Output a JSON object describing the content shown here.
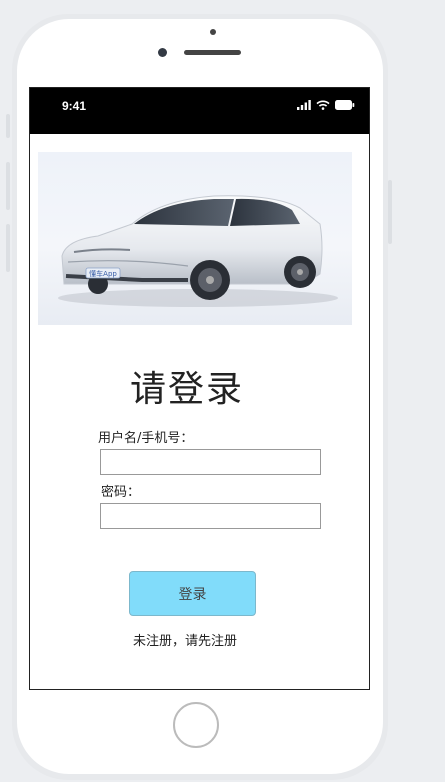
{
  "status_bar": {
    "time": "9:41"
  },
  "login": {
    "title": "请登录",
    "username_label": "用户名/手机号：",
    "username_value": "",
    "password_label": "密码：",
    "password_value": "",
    "submit_label": "登录",
    "register_text": "未注册，请先注册"
  },
  "car_image": {
    "badge_text": "懂车App"
  },
  "colors": {
    "button_bg": "#81dcfa",
    "status_bar_bg": "#000000"
  }
}
